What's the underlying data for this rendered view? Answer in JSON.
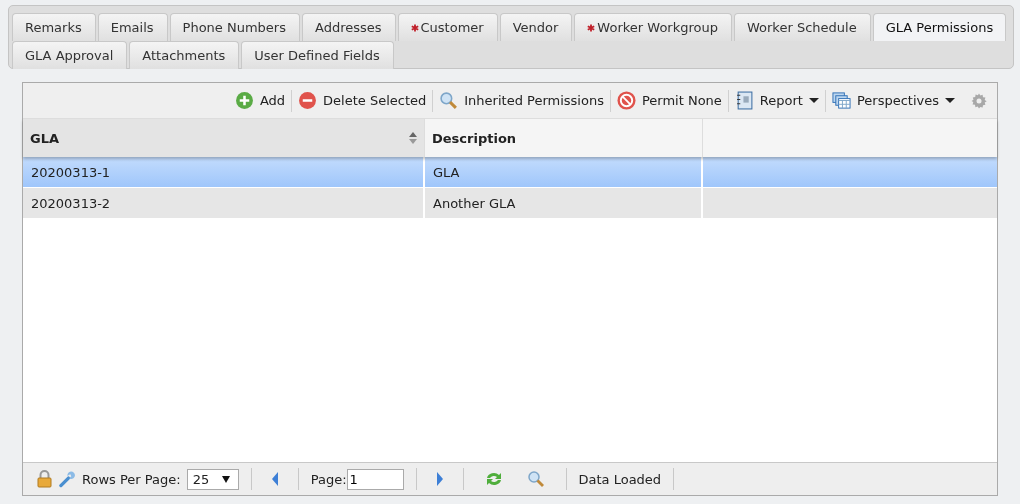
{
  "tabs": [
    {
      "label": "Remarks",
      "required": false,
      "selected": false
    },
    {
      "label": "Emails",
      "required": false,
      "selected": false
    },
    {
      "label": "Phone Numbers",
      "required": false,
      "selected": false
    },
    {
      "label": "Addresses",
      "required": false,
      "selected": false
    },
    {
      "label": "Customer",
      "required": true,
      "selected": false
    },
    {
      "label": "Vendor",
      "required": false,
      "selected": false
    },
    {
      "label": "Worker Workgroup",
      "required": true,
      "selected": false
    },
    {
      "label": "Worker Schedule",
      "required": false,
      "selected": false
    },
    {
      "label": "GLA Permissions",
      "required": false,
      "selected": true
    },
    {
      "label": "GLA Approval",
      "required": false,
      "selected": false
    },
    {
      "label": "Attachments",
      "required": false,
      "selected": false
    },
    {
      "label": "User Defined Fields",
      "required": false,
      "selected": false
    }
  ],
  "toolbar": [
    {
      "kind": "add",
      "label": "Add",
      "dropdown": false
    },
    {
      "kind": "delete",
      "label": "Delete Selected",
      "dropdown": false
    },
    {
      "kind": "search",
      "label": "Inherited Permissions",
      "dropdown": false
    },
    {
      "kind": "deny",
      "label": "Permit None",
      "dropdown": false
    },
    {
      "kind": "report",
      "label": "Report",
      "dropdown": true
    },
    {
      "kind": "perspectives",
      "label": "Perspectives",
      "dropdown": true
    }
  ],
  "table": {
    "columns": [
      {
        "label": "GLA",
        "sortable": true
      },
      {
        "label": "Description",
        "sortable": false
      }
    ],
    "rows": [
      {
        "cells": [
          "20200313-1",
          "GLA"
        ],
        "selected": true
      },
      {
        "cells": [
          "20200313-2",
          "Another GLA"
        ],
        "selected": false
      }
    ]
  },
  "footer": {
    "rows_per_page_label": "Rows Per Page:",
    "rows_per_page": "25",
    "page_label": "Page:",
    "page": "1",
    "status": "Data Loaded"
  }
}
